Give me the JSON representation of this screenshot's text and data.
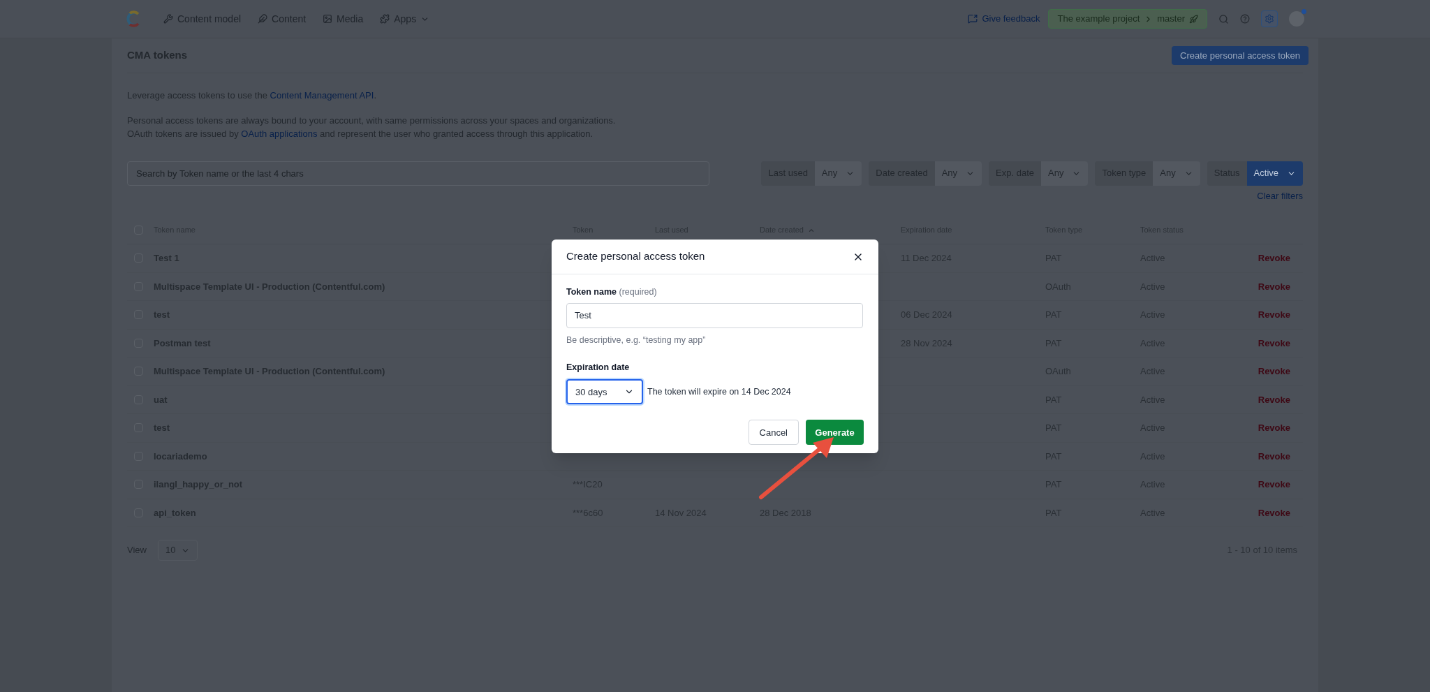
{
  "nav": {
    "items": [
      {
        "label": "Content model",
        "dropdown": false
      },
      {
        "label": "Content",
        "dropdown": false
      },
      {
        "label": "Media",
        "dropdown": false
      },
      {
        "label": "Apps",
        "dropdown": true
      }
    ],
    "feedback": "Give feedback",
    "project": "The example project",
    "environment": "master"
  },
  "page": {
    "title": "CMA tokens",
    "create_button": "Create personal access token",
    "intro": "Leverage access tokens to use the ",
    "intro_link": "Content Management API",
    "intro_end": ".",
    "para1": "Personal access tokens are always bound to your account, with same permissions across your spaces and organizations.",
    "para2_start": "OAuth tokens are issued by ",
    "para2_link": "OAuth applications",
    "para2_end": " and represent the user who granted access through this application."
  },
  "search": {
    "placeholder": "Search by Token name or the last 4 chars"
  },
  "filters": [
    {
      "label": "Last used",
      "value": "Any",
      "applied": false
    },
    {
      "label": "Date created",
      "value": "Any",
      "applied": false
    },
    {
      "label": "Exp. date",
      "value": "Any",
      "applied": false
    },
    {
      "label": "Token type",
      "value": "Any",
      "applied": false
    },
    {
      "label": "Status",
      "value": "Active",
      "applied": true
    }
  ],
  "clear_filters": "Clear filters",
  "table": {
    "select_all_checked": false,
    "columns": [
      {
        "label": "Token name",
        "sorted": false
      },
      {
        "label": "Token",
        "sorted": false
      },
      {
        "label": "Last used",
        "sorted": false
      },
      {
        "label": "Date created",
        "sorted": true
      },
      {
        "label": "Expiration date",
        "sorted": false
      },
      {
        "label": "Token type",
        "sorted": false
      },
      {
        "label": "Token status",
        "sorted": false
      }
    ],
    "rows": [
      {
        "name": "Test 1",
        "expiration_date": "11 Dec 2024",
        "type": "PAT",
        "status": "Active",
        "action": "Revoke",
        "checked": false
      },
      {
        "name": "Multispace Template UI - Production (Contentful.com)",
        "type": "OAuth",
        "status": "Active",
        "action": "Revoke",
        "checked": false
      },
      {
        "name": "test",
        "expiration_date": "06 Dec 2024",
        "type": "PAT",
        "status": "Active",
        "action": "Revoke",
        "checked": false
      },
      {
        "name": "Postman test",
        "expiration_date": "28 Nov 2024",
        "type": "PAT",
        "status": "Active",
        "action": "Revoke",
        "checked": false
      },
      {
        "name": "Multispace Template UI - Production (Contentful.com)",
        "type": "OAuth",
        "status": "Active",
        "action": "Revoke",
        "checked": false
      },
      {
        "name": "uat",
        "type": "PAT",
        "status": "Active",
        "action": "Revoke",
        "checked": false
      },
      {
        "name": "test",
        "type": "PAT",
        "status": "Active",
        "action": "Revoke",
        "checked": false
      },
      {
        "name": "locariademo",
        "type": "PAT",
        "status": "Active",
        "action": "Revoke",
        "checked": false
      },
      {
        "name": "ilangl_happy_or_not",
        "token": "***IC20",
        "type": "PAT",
        "status": "Active",
        "action": "Revoke",
        "checked": false
      },
      {
        "name": "api_token",
        "token": "***6c60",
        "last_used": "14 Nov 2024",
        "date_created": "28 Dec 2018",
        "type": "PAT",
        "status": "Active",
        "action": "Revoke",
        "checked": false
      }
    ]
  },
  "pagination": {
    "view_label": "View",
    "page_size": "10",
    "summary": "1 - 10 of 10 items"
  },
  "dialog": {
    "title": "Create personal access token",
    "name_label": "Token name",
    "name_hint": "(required)",
    "name_value": "Test",
    "help": "Be descriptive, e.g. “testing my app”",
    "expiration_label": "Expiration date",
    "expiration_value": "30 days",
    "expiration_note": "The token will expire on 14 Dec 2024",
    "cancel": "Cancel",
    "generate": "Generate"
  }
}
